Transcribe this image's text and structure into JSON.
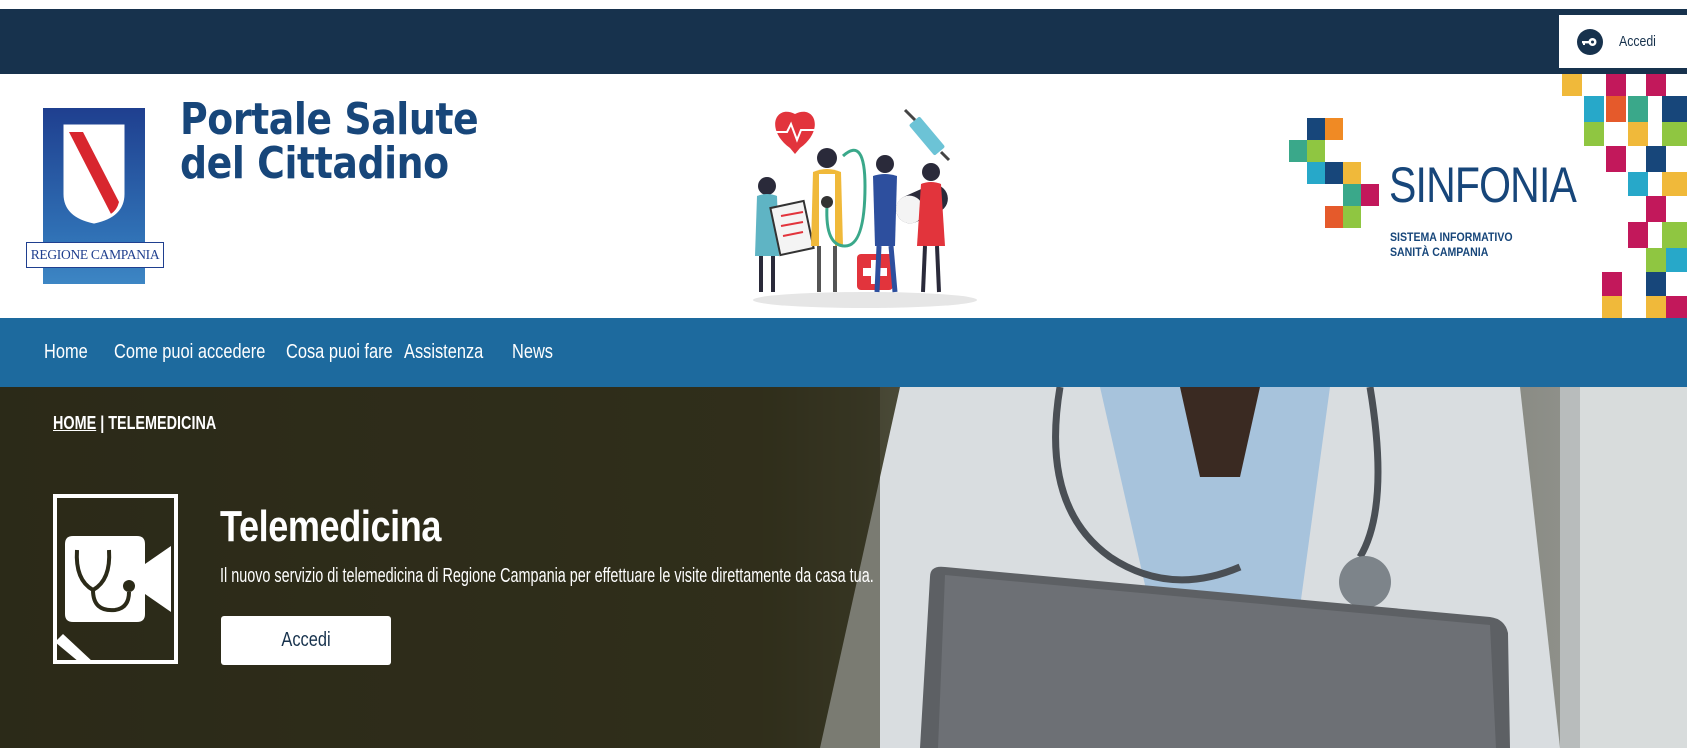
{
  "topbar": {
    "login_label": "Accedi",
    "login_icon": "key-icon",
    "bg_color": "#17324d"
  },
  "header": {
    "region_label": "REGIONE CAMPANIA",
    "portal_title_line1": "Portale Salute",
    "portal_title_line2": "del Cittadino",
    "sinfonia_name": "SINFONIA",
    "sinfonia_sub_line1": "SISTEMA INFORMATIVO",
    "sinfonia_sub_line2": "SANITÀ CAMPANIA",
    "title_color": "#17467a"
  },
  "nav": {
    "bg_color": "#1d6a9e",
    "items": [
      {
        "label": "Home"
      },
      {
        "label": "Come puoi accedere"
      },
      {
        "label": "Cosa puoi fare"
      },
      {
        "label": "Assistenza"
      },
      {
        "label": "News"
      }
    ]
  },
  "hero": {
    "breadcrumb_home": "HOME",
    "breadcrumb_separator": " | ",
    "breadcrumb_current": "TELEMEDICINA",
    "service_icon": "telemedicine-icon",
    "title": "Telemedicina",
    "description": "Il nuovo servizio di telemedicina di Regione Campania per effettuare le visite direttamente da casa tua.",
    "button_label": "Accedi"
  }
}
